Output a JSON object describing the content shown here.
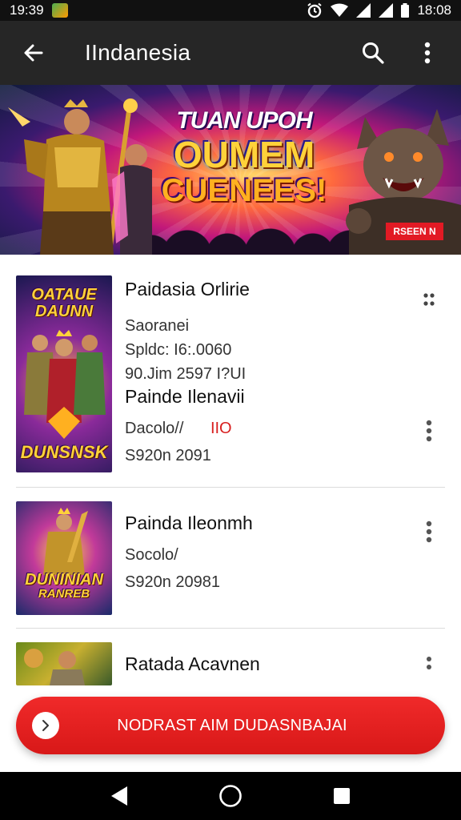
{
  "status_bar": {
    "time_left": "19:39",
    "time_right": "18:08",
    "icons": [
      "app-notification-icon",
      "alarm-icon",
      "wifi-icon",
      "signal-icon",
      "signal-icon",
      "battery-icon"
    ]
  },
  "app_bar": {
    "title": "IIndanesia",
    "back_icon": "arrow-left-icon",
    "search_icon": "search-icon",
    "menu_icon": "more-vert-icon"
  },
  "banner": {
    "line1": "TUAN UPOH",
    "line2": "OUMEM",
    "line3": "CUENEES!",
    "badge": "RSEEN N",
    "colors": {
      "headline": "#ffd23a",
      "badge": "#e21a24"
    }
  },
  "list": {
    "items": [
      {
        "thumb_title": "OATAUE DAUNN",
        "thumb_footer": "DUNSNSK",
        "lines": [
          {
            "text": "Paidasia Orlirie",
            "style": "title"
          },
          {
            "text": "Saoranei",
            "style": "sub"
          },
          {
            "text": "Spldc: I6:.0060",
            "style": "sub"
          },
          {
            "text": "90.Jim 2597 I?UI",
            "style": "sub"
          },
          {
            "text": "Painde Ilenavii",
            "style": "title"
          },
          {
            "text": "Dacolo//",
            "accent": "IIO",
            "style": "sub"
          },
          {
            "text": "S920n 2091",
            "style": "sub"
          }
        ]
      },
      {
        "thumb_title": "DUNINIAN",
        "thumb_footer": "RANREB",
        "lines": [
          {
            "text": "Painda Ileonmh",
            "style": "title"
          },
          {
            "text": "Socolo/",
            "style": "sub"
          },
          {
            "text": "S920n 20981",
            "style": "sub"
          }
        ]
      },
      {
        "thumb_title": "",
        "thumb_footer": "",
        "lines": [
          {
            "text": "Ratada Acavnen",
            "style": "title"
          }
        ]
      }
    ]
  },
  "cta": {
    "label": "NODRAST AIM DUDASNBAJAI",
    "icon": "chevron-right-icon",
    "color": "#e01f1f"
  },
  "nav_bar": {
    "back_icon": "triangle-back-icon",
    "home_icon": "circle-home-icon",
    "recents_icon": "square-recents-icon"
  }
}
